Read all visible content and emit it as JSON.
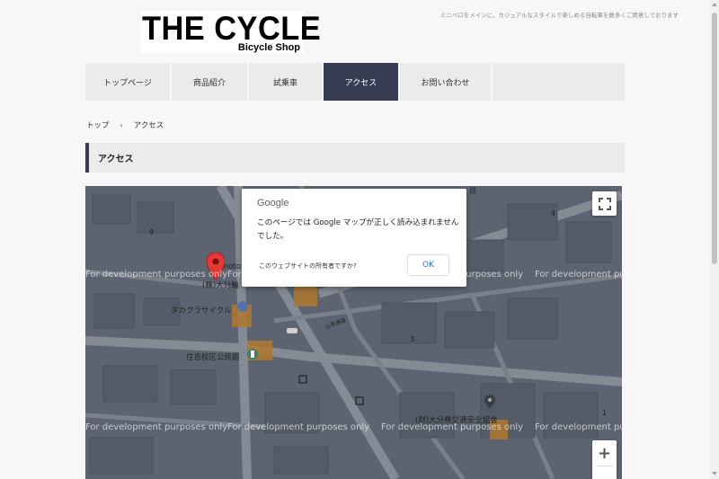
{
  "header": {
    "logo_main": "THE  CYCLE",
    "logo_sub": "Bicycle Shop",
    "tagline": "ミニベロをメインに、カジュアルなスタイルで楽しめる自転車を数多くご用意しております"
  },
  "nav": {
    "items": [
      {
        "label": "トップページ",
        "active": false
      },
      {
        "label": "商品紹介",
        "active": false
      },
      {
        "label": "試乗車",
        "active": false
      },
      {
        "label": "アクセス",
        "active": true
      },
      {
        "label": "お問い合わせ",
        "active": false
      }
    ]
  },
  "breadcrumb": {
    "home": "トップ",
    "separator": "›",
    "current": "アクセス"
  },
  "section": {
    "title": "アクセス"
  },
  "map": {
    "watermark": "For development purposes only",
    "labels": {
      "shop_partial": "(株)大分輪",
      "takakura": "タカクラサイクル",
      "kominkan": "住吉校区公民館",
      "kotsu": "(財)大分県交通安全協会",
      "road": "山茶通道",
      "partial_moto": "moto",
      "num_9": "9",
      "num_3": "3",
      "num_4": "4",
      "num_1": "1",
      "num_top": "目"
    },
    "controls": {
      "fullscreen_icon": "fullscreen-icon",
      "zoom_in": "+",
      "zoom_out": "−"
    }
  },
  "dialog": {
    "brand": "Google",
    "message": "このページでは Google マップが正しく読み込まれませんでした。",
    "question": "このウェブサイトの所有者ですか?",
    "ok_label": "OK"
  },
  "colors": {
    "accent": "#383c52",
    "nav_bg": "#ebebeb",
    "map_overlay": "#5b6371",
    "link_blue": "#1a73e8"
  }
}
